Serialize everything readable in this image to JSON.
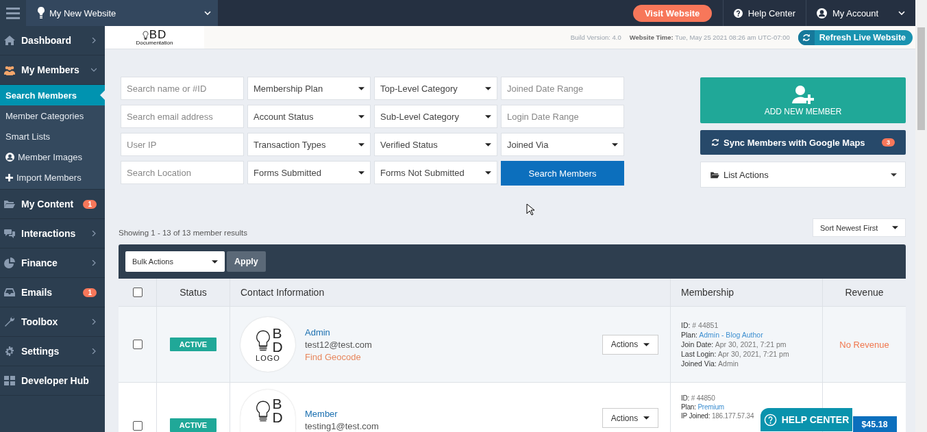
{
  "topbar": {
    "site_name": "My New Website",
    "visit_button": "Visit Website",
    "help_center": "Help Center",
    "my_account": "My Account"
  },
  "sidebar": {
    "items": [
      {
        "label": "Dashboard",
        "kind": "menu",
        "expanded": false
      },
      {
        "label": "My Members",
        "kind": "menu",
        "expanded": true,
        "children": [
          {
            "label": "Search Members",
            "selected": true
          },
          {
            "label": "Member Categories",
            "selected": false
          },
          {
            "label": "Smart Lists",
            "selected": false
          },
          {
            "label": "Member Images",
            "selected": false
          },
          {
            "label": "Import Members",
            "selected": false
          }
        ]
      },
      {
        "label": "My Content",
        "kind": "badge",
        "badge": "1"
      },
      {
        "label": "Interactions",
        "kind": "menu",
        "expanded": false
      },
      {
        "label": "Finance",
        "kind": "menu",
        "expanded": false
      },
      {
        "label": "Emails",
        "kind": "badge",
        "badge": "1"
      },
      {
        "label": "Toolbox",
        "kind": "menu",
        "expanded": false
      },
      {
        "label": "Settings",
        "kind": "menu",
        "expanded": false
      },
      {
        "label": "Developer Hub",
        "kind": "link"
      }
    ]
  },
  "header": {
    "logo": {
      "mark": "BD",
      "caption": "Documentation"
    },
    "build_label": "Build Version:",
    "build_value": "4.0",
    "time_label": "Website Time:",
    "time_value": "Tue, May 25 2021 08:26 am UTC-07:00",
    "refresh_button": "Refresh Live Website"
  },
  "filters": [
    {
      "kind": "input",
      "placeholder": "Search name or #ID"
    },
    {
      "kind": "select",
      "label": "Membership Plan"
    },
    {
      "kind": "select",
      "label": "Top-Level Category"
    },
    {
      "kind": "input",
      "placeholder": "Joined Date Range"
    },
    {
      "kind": "input",
      "placeholder": "Search email address"
    },
    {
      "kind": "select",
      "label": "Account Status"
    },
    {
      "kind": "select",
      "label": "Sub-Level Category"
    },
    {
      "kind": "input",
      "placeholder": "Login Date Range"
    },
    {
      "kind": "input",
      "placeholder": "User IP"
    },
    {
      "kind": "select",
      "label": "Transaction Types"
    },
    {
      "kind": "select",
      "label": "Verified Status"
    },
    {
      "kind": "select",
      "label": "Joined Via"
    },
    {
      "kind": "input",
      "placeholder": "Search Location"
    },
    {
      "kind": "select",
      "label": "Forms Submitted"
    },
    {
      "kind": "select",
      "label": "Forms Not Submitted"
    },
    {
      "kind": "button",
      "label": "Search Members"
    }
  ],
  "actions": {
    "add_member": "ADD NEW MEMBER",
    "sync_button": "Sync Members with Google Maps",
    "sync_badge": "3",
    "list_actions": "List Actions"
  },
  "results_summary": "Showing 1 - 13 of 13 member results",
  "sort": "Sort Newest First",
  "table": {
    "bulk_actions": "Bulk Actions",
    "apply_button": "Apply",
    "select_all": {
      "checked": false
    },
    "columns": [
      "Status",
      "Contact Information",
      "Membership",
      "Revenue"
    ],
    "rows": [
      {
        "checked": false,
        "status": "ACTIVE",
        "avatar": {
          "mark": "BD",
          "caption": "LOGO"
        },
        "name": "Admin",
        "email": "test12@test.com",
        "geocode_link": "Find Geocode",
        "action_button": "Actions",
        "membership": [
          {
            "label": "ID:",
            "value": "# 44851",
            "kind": "text"
          },
          {
            "label": "Plan:",
            "value": "Admin - Blog Author",
            "kind": "link"
          },
          {
            "label": "Join Date:",
            "value": "Apr 30, 2021, 7:21 pm",
            "kind": "text"
          },
          {
            "label": "Last Login:",
            "value": "Apr 30, 2021, 7:21 pm",
            "kind": "text"
          },
          {
            "label": "Joined Via:",
            "value": "Admin",
            "kind": "text"
          }
        ],
        "revenue": {
          "kind": "none",
          "text": "No Revenue"
        }
      },
      {
        "checked": false,
        "status": "ACTIVE",
        "avatar": {
          "mark": "BD"
        },
        "name": "Member",
        "email": "testing1@test.com",
        "action_button": "Actions",
        "membership": [
          {
            "label": "ID:",
            "value": "# 44850",
            "kind": "text"
          },
          {
            "label": "Plan:",
            "value": "Premium",
            "kind": "link"
          },
          {
            "label": "IP Joined:",
            "value": "186.177.57.34",
            "kind": "text"
          }
        ],
        "revenue": {
          "kind": "amount",
          "text": "$45.18"
        }
      }
    ]
  },
  "help_widget": "HELP CENTER"
}
